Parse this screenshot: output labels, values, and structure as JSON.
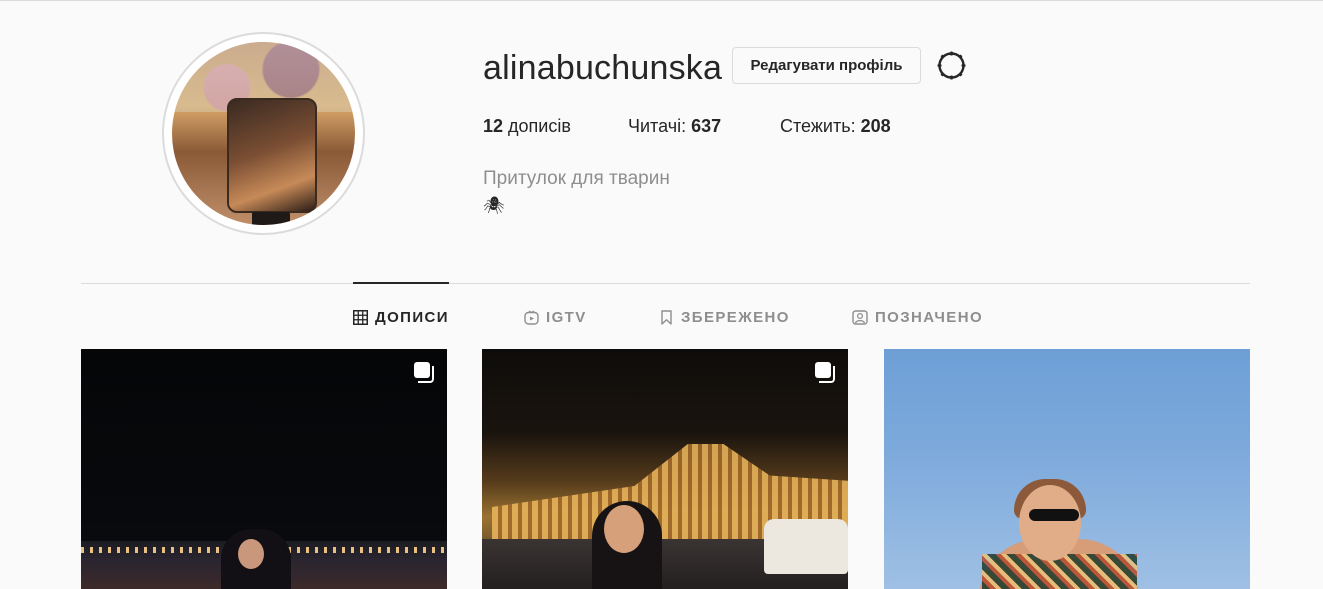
{
  "profile": {
    "username": "alinabuchunska",
    "edit_button_label": "Редагувати профіль",
    "settings_icon": "gear-icon",
    "stats": {
      "posts_count": "12",
      "posts_label": "дописів",
      "followers_label": "Читачі:",
      "followers_count": "637",
      "following_label": "Стежить:",
      "following_count": "208"
    },
    "bio_name": "Притулок для тварин",
    "bio_emoji": "🕷"
  },
  "tabs": [
    {
      "label": "ДОПИСИ",
      "icon": "grid-icon",
      "active": true
    },
    {
      "label": "IGTV",
      "icon": "igtv-icon",
      "active": false
    },
    {
      "label": "ЗБЕРЕЖЕНО",
      "icon": "bookmark-icon",
      "active": false
    },
    {
      "label": "ПОЗНАЧЕНО",
      "icon": "tagged-icon",
      "active": false
    }
  ],
  "posts": [
    {
      "multi": true,
      "icon": "carousel-icon"
    },
    {
      "multi": true,
      "icon": "carousel-icon"
    },
    {
      "multi": false
    }
  ],
  "colors": {
    "text_primary": "#262626",
    "text_secondary": "#8e8e8e",
    "border": "#dbdbdb",
    "background": "#fafafa"
  }
}
